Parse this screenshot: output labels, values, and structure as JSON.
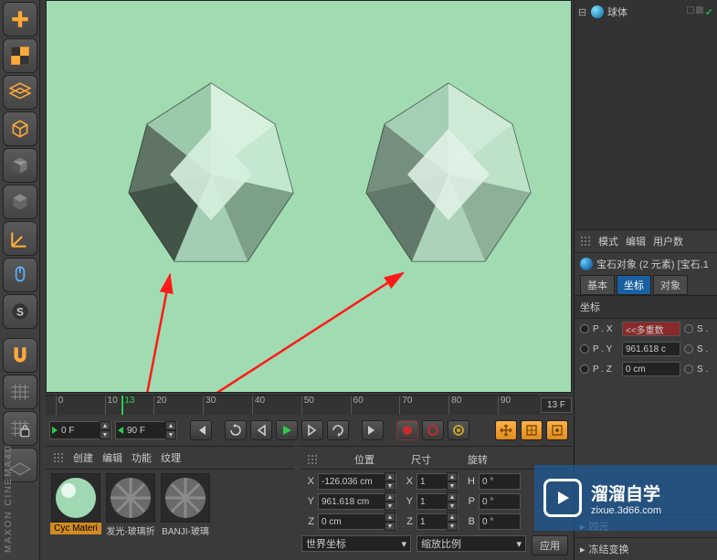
{
  "brand": "MAXON CINEMA4D",
  "viewport": {
    "bg": "#a1dbb2"
  },
  "timeline": {
    "ticks": [
      "0",
      "10",
      "13",
      "20",
      "30",
      "40",
      "50",
      "60",
      "70",
      "80",
      "90"
    ],
    "playhead_frame": 13,
    "right_badge": "13 F",
    "start_frame": "0 F",
    "end_frame": "90 F"
  },
  "materials": {
    "menu": {
      "create": "创建",
      "edit": "编辑",
      "function": "功能",
      "texture": "纹理"
    },
    "slots": [
      {
        "label": "Cyc Materi",
        "color": "#9fd8b3",
        "selected": true
      },
      {
        "label": "发光-玻璃折",
        "color": "#888",
        "selected": false
      },
      {
        "label": "BANJI-玻璃",
        "color": "#888",
        "selected": false
      }
    ]
  },
  "coord": {
    "head": {
      "position": "位置",
      "size": "尺寸",
      "rotation": "旋转"
    },
    "rows": [
      {
        "axis": "X",
        "pos": "-126.036 cm",
        "size": "1",
        "rot_label": "H",
        "rot": "0 °"
      },
      {
        "axis": "Y",
        "pos": "961.618 cm",
        "size": "1",
        "rot_label": "P",
        "rot": "0 °"
      },
      {
        "axis": "Z",
        "pos": "0 cm",
        "size": "1",
        "rot_label": "B",
        "rot": "0 °"
      }
    ],
    "footer": {
      "space": "世界坐标",
      "scale_mode": "缩放比例",
      "apply": "应用"
    }
  },
  "objects": {
    "tree": [
      {
        "name": "球体",
        "icon_color": "#49b7e8"
      }
    ]
  },
  "attr": {
    "menu": {
      "mode": "模式",
      "edit": "编辑",
      "userdata": "用户数"
    },
    "title": "宝石对象 (2 元素) [宝石.1",
    "tabs": {
      "basic": "基本",
      "coord": "坐标",
      "object": "对象"
    },
    "section": "坐标",
    "rows": [
      {
        "l1": "P . X",
        "v": "<<多重数",
        "warn": true,
        "l2": "S ."
      },
      {
        "l1": "P . Y",
        "v": "961.618 c",
        "warn": false,
        "l2": "S ."
      },
      {
        "l1": "P . Z",
        "v": "0 cm",
        "warn": false,
        "l2": "S ."
      }
    ],
    "acc1": "四元",
    "acc2": "冻结变换"
  },
  "watermark": {
    "title": "溜溜自学",
    "url": "zixue.3d66.com"
  },
  "icons": {
    "mouse": "mouse-icon",
    "sphere": "sphere-icon",
    "magnet": "magnet-icon",
    "grid": "grid-icon",
    "lock": "lock-grid-icon",
    "floor": "floor-icon"
  }
}
